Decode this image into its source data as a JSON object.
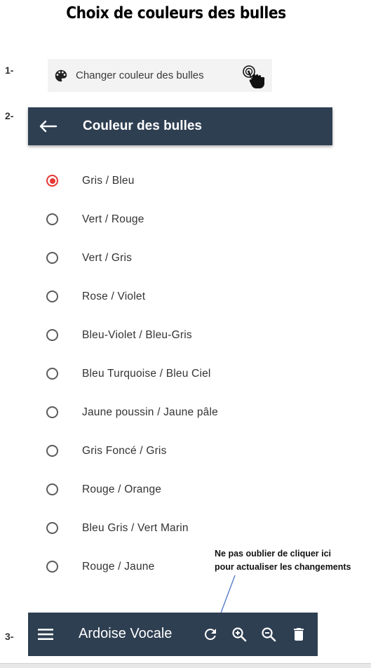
{
  "page_title": "Choix de couleurs des bulles",
  "steps": [
    "1-",
    "2-",
    "3-"
  ],
  "menu_item": {
    "label": "Changer couleur des bulles"
  },
  "dialog": {
    "title": "Couleur des bulles",
    "options": [
      {
        "label": "Gris / Bleu",
        "selected": true
      },
      {
        "label": "Vert / Rouge",
        "selected": false
      },
      {
        "label": "Vert / Gris",
        "selected": false
      },
      {
        "label": "Rose / Violet",
        "selected": false
      },
      {
        "label": "Bleu-Violet / Bleu-Gris",
        "selected": false
      },
      {
        "label": "Bleu Turquoise / Bleu Ciel",
        "selected": false
      },
      {
        "label": "Jaune poussin / Jaune pâle",
        "selected": false
      },
      {
        "label": "Gris Foncé / Gris",
        "selected": false
      },
      {
        "label": "Rouge / Orange",
        "selected": false
      },
      {
        "label": "Bleu Gris / Vert Marin",
        "selected": false
      },
      {
        "label": "Rouge / Jaune",
        "selected": false
      }
    ]
  },
  "note": {
    "line1": "Ne pas oublier de cliquer ici",
    "line2": "pour actualiser les changements"
  },
  "bottom_bar": {
    "title": "Ardoise Vocale",
    "icons": [
      "menu-icon",
      "refresh-icon",
      "zoom-in-icon",
      "zoom-out-icon",
      "delete-icon"
    ]
  },
  "colors": {
    "appbar": "#2e3f52",
    "radio_selected": "#e53935",
    "radio_unselected": "#5c5c5c"
  }
}
